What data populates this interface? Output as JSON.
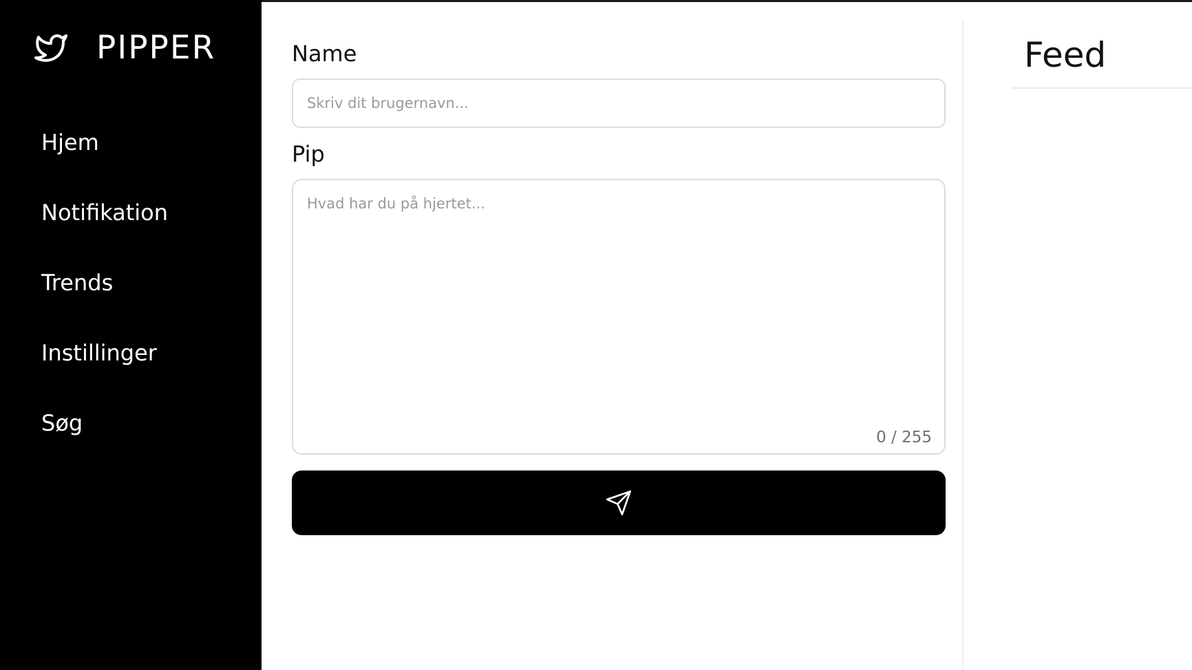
{
  "brand": {
    "name": "PIPPER",
    "icon": "bird-icon"
  },
  "sidebar": {
    "items": [
      {
        "label": "Hjem"
      },
      {
        "label": "Notifikation"
      },
      {
        "label": "Trends"
      },
      {
        "label": "Instillinger"
      },
      {
        "label": "Søg"
      }
    ]
  },
  "form": {
    "name_label": "Name",
    "name_placeholder": "Skriv dit brugernavn...",
    "name_value": "",
    "pip_label": "Pip",
    "pip_placeholder": "Hvad har du på hjertet...",
    "pip_value": "",
    "counter": "0 / 255",
    "send_icon": "send-icon"
  },
  "feed": {
    "title": "Feed"
  },
  "colors": {
    "sidebar_bg": "#000000",
    "button_bg": "#000000",
    "input_border": "#dcdcdc",
    "placeholder": "#9a9a9a"
  }
}
